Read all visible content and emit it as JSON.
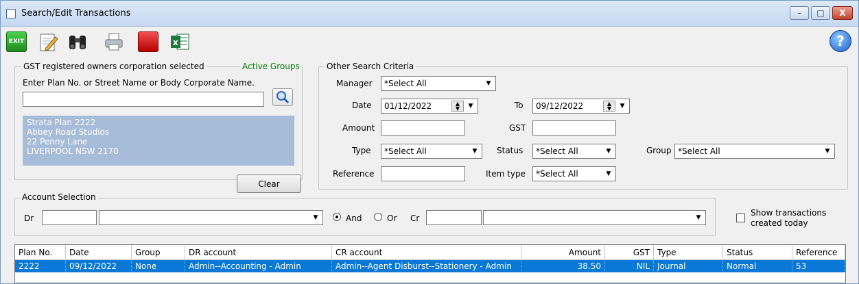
{
  "window": {
    "title": "Search/Edit Transactions",
    "minimize": "–",
    "restore": "□",
    "close": "X"
  },
  "toolbar": {
    "exit_label": "EXIT",
    "help_label": "?"
  },
  "gst": {
    "legend": "GST registered owners corporation selected",
    "active_groups": "Active Groups",
    "prompt": "Enter Plan No. or Street Name or Body Corporate Name.",
    "search_value": "",
    "plan_lines": [
      "Strata Plan 2222",
      "Abbey Road Studios",
      "22 Penny Lane",
      "LIVERPOOL  NSW  2170"
    ],
    "clear_label": "Clear"
  },
  "criteria": {
    "legend": "Other Search Criteria",
    "manager_label": "Manager",
    "manager_value": "*Select All",
    "date_label": "Date",
    "date_value": "01/12/2022",
    "to_label": "To",
    "to_value": "09/12/2022",
    "amount_label": "Amount",
    "amount_value": "",
    "gst_label": "GST",
    "gst_value": "",
    "type_label": "Type",
    "type_value": "*Select All",
    "status_label": "Status",
    "status_value": "*Select All",
    "group_label": "Group",
    "group_value": "*Select All",
    "reference_label": "Reference",
    "reference_value": "",
    "item_type_label": "Item type",
    "item_type_value": "*Select All"
  },
  "account": {
    "legend": "Account Selection",
    "dr_label": "Dr",
    "dr_code": "",
    "dr_name": "",
    "and_label": "And",
    "or_label": "Or",
    "and_selected": true,
    "cr_label": "Cr",
    "cr_code": "",
    "cr_name": ""
  },
  "show_today": {
    "line1": "Show transactions",
    "line2": "created today",
    "checked": false
  },
  "grid": {
    "columns": [
      "Plan No.",
      "Date",
      "Group",
      "DR account",
      "CR account",
      "Amount",
      "GST",
      "Type",
      "Status",
      "Reference"
    ],
    "rows": [
      [
        "2222",
        "09/12/2022",
        "None",
        "Admin--Accounting - Admin",
        "Admin--Agent Disburst--Stationery - Admin",
        "38.50",
        "NIL",
        "Journal",
        "Normal",
        "53"
      ]
    ]
  },
  "colors": {
    "selection": "#0a78d7",
    "plan_box": "#a6bcd8",
    "active_groups": "#008000"
  }
}
